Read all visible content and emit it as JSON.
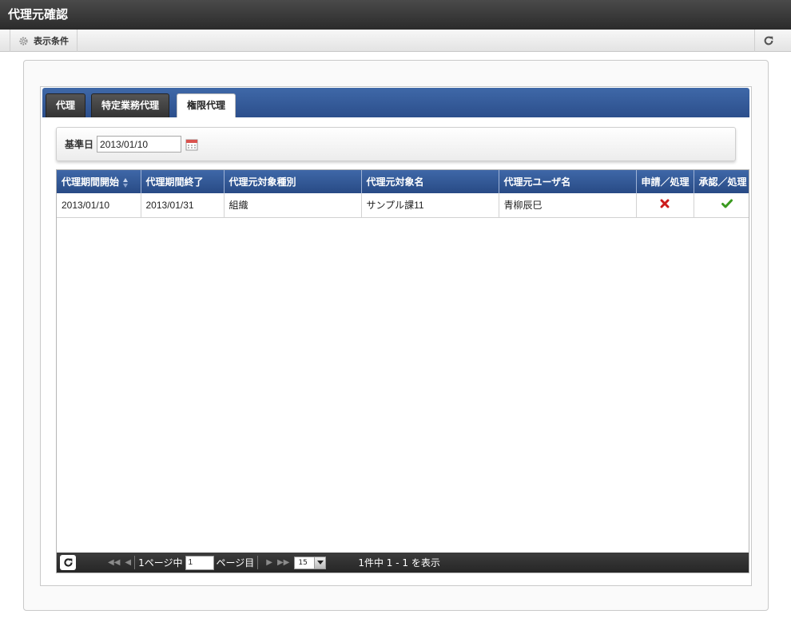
{
  "window": {
    "title": "代理元確認"
  },
  "toolbar": {
    "display_conditions_label": "表示条件"
  },
  "tabs": [
    {
      "label": "代理",
      "active": false
    },
    {
      "label": "特定業務代理",
      "active": false
    },
    {
      "label": "権限代理",
      "active": true
    }
  ],
  "filter": {
    "label": "基準日",
    "value": "2013/01/10"
  },
  "table": {
    "columns": [
      "代理期間開始",
      "代理期間終了",
      "代理元対象種別",
      "代理元対象名",
      "代理元ユーザ名",
      "申請／処理",
      "承認／処理"
    ],
    "rows": [
      {
        "start": "2013/01/10",
        "end": "2013/01/31",
        "target_type": "組織",
        "target_name": "サンプル課11",
        "user_name": "青柳辰巳",
        "apply_icon": "cross-icon",
        "approve_icon": "check-icon"
      }
    ]
  },
  "pager": {
    "page_prefix": "1ページ中",
    "page_value": "1",
    "page_suffix": "ページ目",
    "page_size": "15",
    "summary": "1件中 1 - 1 を表示"
  },
  "colors": {
    "header_blue": "#2c4f8c",
    "title_dark": "#2b2b2b",
    "cross_red": "#cc1b1b",
    "check_green": "#3a9a1f"
  }
}
